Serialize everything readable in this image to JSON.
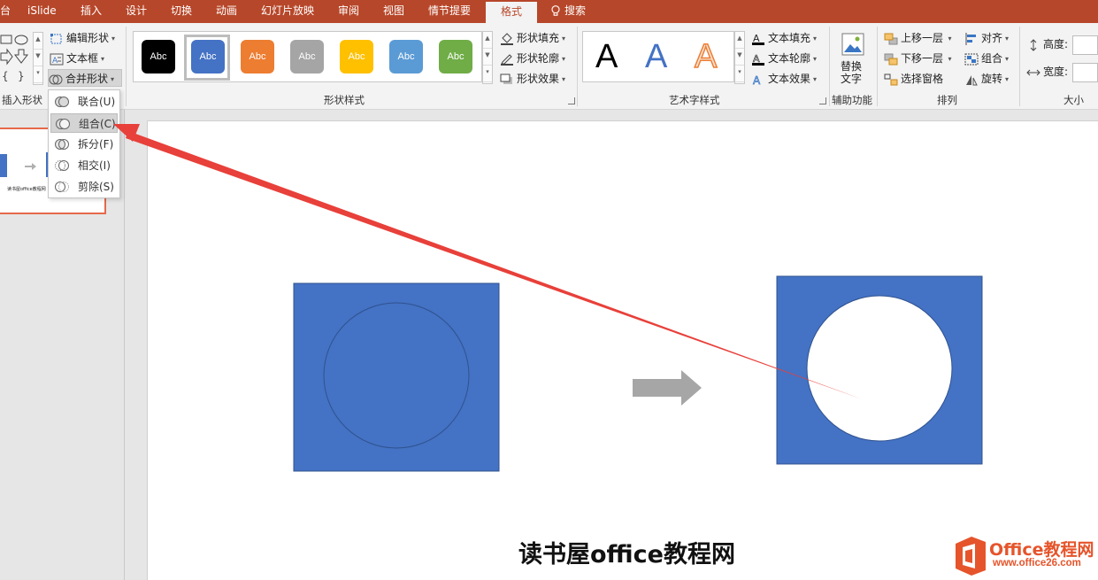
{
  "tabs": [
    {
      "label": "台"
    },
    {
      "label": "iSlide"
    },
    {
      "label": "插入"
    },
    {
      "label": "设计"
    },
    {
      "label": "切换"
    },
    {
      "label": "动画"
    },
    {
      "label": "幻灯片放映"
    },
    {
      "label": "审阅"
    },
    {
      "label": "视图"
    },
    {
      "label": "情节提要"
    },
    {
      "label": "格式",
      "active": true
    }
  ],
  "search_label": "搜索",
  "insert_shapes": {
    "edit_shape": "编辑形状",
    "text_box": "文本框",
    "merge_shapes": "合并形状",
    "group_label": "插入形状"
  },
  "merge_menu": [
    {
      "label": "联合(U)"
    },
    {
      "label": "组合(C)",
      "highlighted": true
    },
    {
      "label": "拆分(F)"
    },
    {
      "label": "相交(I)"
    },
    {
      "label": "剪除(S)"
    }
  ],
  "shape_styles": {
    "swatches": [
      {
        "text": "Abc",
        "color": "#000000"
      },
      {
        "text": "Abc",
        "color": "#4472c4",
        "selected": true
      },
      {
        "text": "Abc",
        "color": "#ed7d31"
      },
      {
        "text": "Abc",
        "color": "#a5a5a5"
      },
      {
        "text": "Abc",
        "color": "#ffc000"
      },
      {
        "text": "Abc",
        "color": "#5b9bd5"
      },
      {
        "text": "Abc",
        "color": "#70ad47"
      }
    ],
    "fill": "形状填充",
    "outline": "形状轮廓",
    "effects": "形状效果",
    "group_label": "形状样式"
  },
  "wordart": {
    "samples": [
      {
        "letter": "A",
        "style": "black"
      },
      {
        "letter": "A",
        "style": "blue"
      },
      {
        "letter": "A",
        "style": "orange-outline"
      }
    ],
    "text_fill": "文本填充",
    "text_outline": "文本轮廓",
    "text_effects": "文本效果",
    "group_label": "艺术字样式"
  },
  "accessibility": {
    "alt_text_line1": "替换",
    "alt_text_line2": "文字",
    "group_label": "辅助功能"
  },
  "arrange": {
    "bring_forward": "上移一层",
    "send_backward": "下移一层",
    "selection_pane": "选择窗格",
    "align": "对齐",
    "group": "组合",
    "rotate": "旋转",
    "group_label": "排列"
  },
  "size": {
    "height_label": "高度:",
    "width_label": "宽度:",
    "group_label": "大小"
  },
  "thumbnail_caption": "读书屋office教程网",
  "slide": {
    "left_shape_color": "#4472c4",
    "right_shape_color": "#4472c4",
    "arrow_color": "#a6a6a6",
    "footer_text": "读书屋office教程网"
  },
  "logo": {
    "line1": "Office教程网",
    "line2": "www.office26.com"
  },
  "annotation_color": "#e8403a"
}
